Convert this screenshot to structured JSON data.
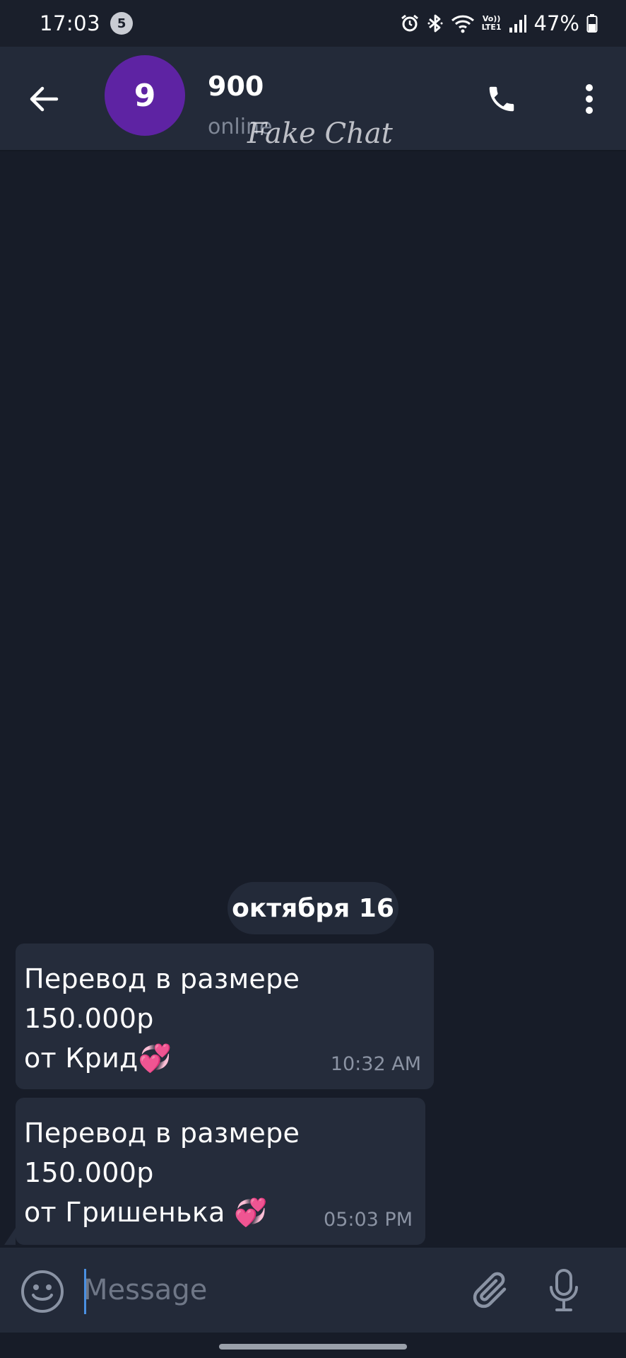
{
  "status_bar": {
    "time": "17:03",
    "notification_count": "5",
    "network_label_top": "Vo))",
    "network_label_bottom": "LTE1",
    "battery_percent": "47%"
  },
  "header": {
    "avatar_letter": "9",
    "avatar_color": "#5e23a3",
    "name": "900",
    "status": "online",
    "watermark": "Fake Chat"
  },
  "chat": {
    "date_label": "октября 16",
    "messages": [
      {
        "line1": "Перевод в размере 150.000р",
        "line2": "от Крид💞",
        "time": "10:32 AM"
      },
      {
        "line1": "Перевод в размере 150.000р",
        "line2": "от Гришенька 💞",
        "time": "05:03 PM"
      }
    ]
  },
  "input": {
    "placeholder": "Message"
  },
  "icons": {
    "back": "arrow-left",
    "call": "phone",
    "more": "vertical-dots",
    "emoji": "smiley-face",
    "attach": "paperclip",
    "mic": "microphone"
  }
}
